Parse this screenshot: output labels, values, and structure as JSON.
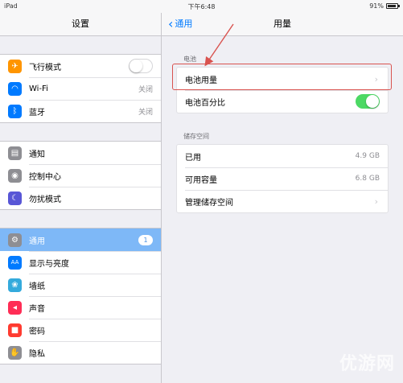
{
  "status": {
    "device": "iPad",
    "time": "下午6:48",
    "battery": "91%",
    "battery_level": 0.91
  },
  "master": {
    "title": "设置",
    "group1": [
      {
        "label": "飞行模式",
        "icon": "airplane-icon",
        "color": "#ff9500",
        "glyph": "✈",
        "control": "toggle-off"
      },
      {
        "label": "Wi-Fi",
        "icon": "wifi-icon",
        "color": "#007aff",
        "glyph": "◠",
        "detail": "关闭"
      },
      {
        "label": "蓝牙",
        "icon": "bluetooth-icon",
        "color": "#007aff",
        "glyph": "ᛒ",
        "detail": "关闭"
      }
    ],
    "group2": [
      {
        "label": "通知",
        "icon": "notifications-icon",
        "color": "#8e8e93",
        "glyph": "▤"
      },
      {
        "label": "控制中心",
        "icon": "control-center-icon",
        "color": "#8e8e93",
        "glyph": "◉"
      },
      {
        "label": "勿扰模式",
        "icon": "moon-icon",
        "color": "#5856d6",
        "glyph": "☾"
      }
    ],
    "group3": [
      {
        "label": "通用",
        "icon": "gear-icon",
        "color": "#8e8e93",
        "glyph": "⚙",
        "badge": "1",
        "selected": true
      },
      {
        "label": "显示与亮度",
        "icon": "display-icon",
        "color": "#007aff",
        "glyph": "AA"
      },
      {
        "label": "墙纸",
        "icon": "wallpaper-icon",
        "color": "#34aadc",
        "glyph": "❀"
      },
      {
        "label": "声音",
        "icon": "sound-icon",
        "color": "#ff2d55",
        "glyph": "◂"
      },
      {
        "label": "密码",
        "icon": "lock-icon",
        "color": "#ff3b30",
        "glyph": "■"
      },
      {
        "label": "隐私",
        "icon": "hand-icon",
        "color": "#8e8e93",
        "glyph": "✋"
      }
    ]
  },
  "detail": {
    "back_label": "通用",
    "title": "用量",
    "battery_section": "电池",
    "battery_usage": "电池用量",
    "battery_percent": "电池百分比",
    "storage_section": "储存空间",
    "used_label": "已用",
    "used_value": "4.9 GB",
    "available_label": "可用容量",
    "available_value": "6.8 GB",
    "manage_label": "管理储存空间"
  },
  "colors": {
    "accent": "#007aff",
    "toggle_on": "#4cd964",
    "selected_row": "#7eb8f7",
    "annotation": "#d9534f"
  },
  "watermark": "优游网"
}
